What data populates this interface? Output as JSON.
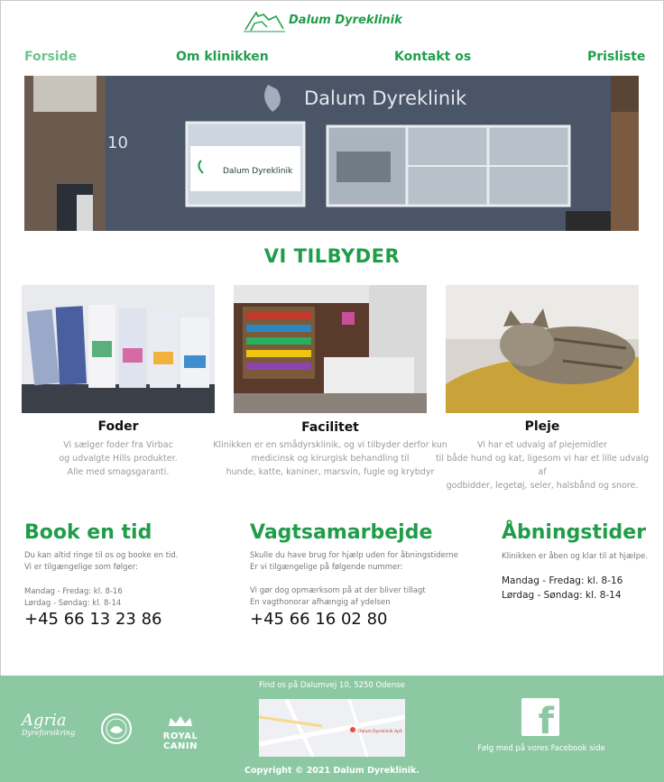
{
  "brand": {
    "name": "Dalum Dyreklinik",
    "color": "#1f9d48"
  },
  "nav": {
    "items": [
      {
        "label": "Forside",
        "active": true
      },
      {
        "label": "Om klinikken"
      },
      {
        "label": "Kontakt os"
      },
      {
        "label": "Prisliste"
      }
    ]
  },
  "hero": {
    "sign_text": "Dalum Dyreklinik",
    "window_sign": "Dalum Dyreklinik",
    "house_number": "10"
  },
  "offers": {
    "title": "VI TILBYDER",
    "cards": [
      {
        "title": "Foder",
        "lines": [
          "Vi sælger foder fra Virbac",
          "og udvalgte Hills produkter.",
          "Alle med smagsgaranti."
        ]
      },
      {
        "title": "Facilitet",
        "lines": [
          "Klinikken er en smådyrsklinik, og vi tilbyder derfor kun",
          "medicinsk og kirurgisk behandling til",
          "hunde, katte, kaniner, marsvin, fugle og krybdyr"
        ]
      },
      {
        "title": "Pleje",
        "lines": [
          "Vi har et udvalg af plejemidler",
          "til både hund og kat, ligesom vi har et lille udvalg af",
          "godbidder, legetøj, seler, halsbånd og snore."
        ]
      }
    ]
  },
  "booking": {
    "title": "Book en tid",
    "lines": [
      "Du kan altid ringe til os og booke en tid.",
      "Vi er tilgængelige som følger:"
    ],
    "hours": [
      "Mandag - Fredag: kl. 8-16",
      "Lørdag - Søndag: kl. 8-14"
    ],
    "phone": "+45 66 13 23 86"
  },
  "vagt": {
    "title": "Vagtsamarbejde",
    "lines": [
      "Skulle du have brug for hjælp uden for åbningstiderne",
      "Er vi tilgængelige på følgende nummer:"
    ],
    "notes": [
      "Vi gør dog opmærksom på at der bliver tillagt",
      "En vagthonorar afhængig af ydelsen"
    ],
    "phone": "+45 66 16 02 80"
  },
  "opening": {
    "title": "Åbningstider",
    "line": "Klinikken er åben og klar til at hjælpe.",
    "hours": [
      "Mandag - Fredag: kl. 8-16",
      "Lørdag - Søndag: kl. 8-14"
    ]
  },
  "footer": {
    "address": "Find os på Dalumvej 10, 5250 Odense",
    "partners": [
      "Agria",
      "Dyreforsikring",
      "ROYAL CANIN"
    ],
    "map_label": "Dalum Dyreklinik ApS",
    "facebook_text": "Følg med på vores Facebook side",
    "copyright": "Copyright © 2021 Dalum Dyreklinik.",
    "bg_color": "#8cc9a3"
  }
}
